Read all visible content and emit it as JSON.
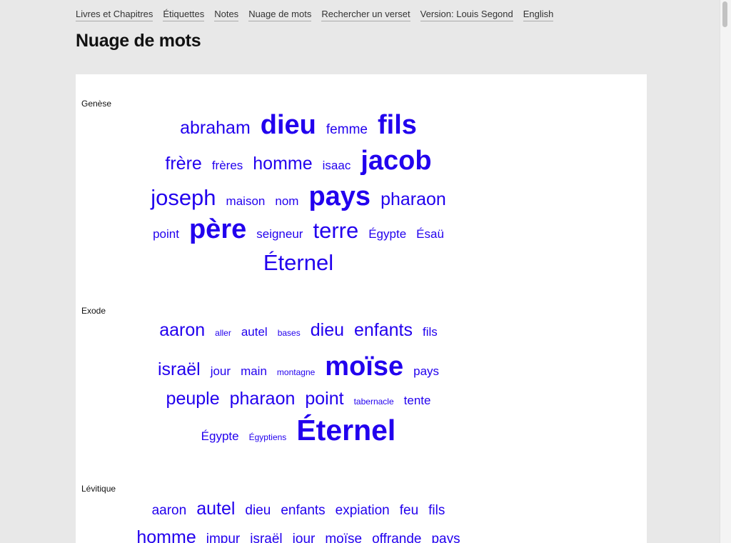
{
  "nav": {
    "books": "Livres et Chapitres",
    "tags": "Étiquettes",
    "notes": "Notes",
    "wordcloud": "Nuage de mots",
    "search": "Rechercher un verset",
    "version": "Version: Louis Segond",
    "language": "English"
  },
  "page": {
    "title": "Nuage de mots"
  },
  "books": [
    {
      "name": "Genèse",
      "rows": [
        [
          "abraham",
          "dieu",
          "femme",
          "fils"
        ],
        [
          "frère",
          "frères",
          "homme",
          "isaac",
          "jacob"
        ],
        [
          "joseph",
          "maison",
          "nom",
          "pays",
          "pharaon"
        ],
        [
          "point",
          "père",
          "seigneur",
          "terre",
          "Égypte",
          "Ésaü"
        ],
        [
          "Éternel"
        ]
      ]
    },
    {
      "name": "Exode",
      "rows": [
        [
          "aaron",
          "aller",
          "autel",
          "bases",
          "dieu",
          "enfants",
          "fils"
        ],
        [
          "israël",
          "jour",
          "main",
          "montagne",
          "moïse",
          "pays"
        ],
        [
          "peuple",
          "pharaon",
          "point",
          "tabernacle",
          "tente"
        ],
        [
          "Égypte",
          "Égyptiens",
          "Éternel"
        ]
      ]
    },
    {
      "name": "Lévitique",
      "rows": [
        [
          "aaron",
          "autel",
          "dieu",
          "enfants",
          "expiation",
          "feu",
          "fils"
        ],
        [
          "homme",
          "impur",
          "israël",
          "jour",
          "moïse",
          "offrande",
          "pays"
        ]
      ]
    }
  ]
}
